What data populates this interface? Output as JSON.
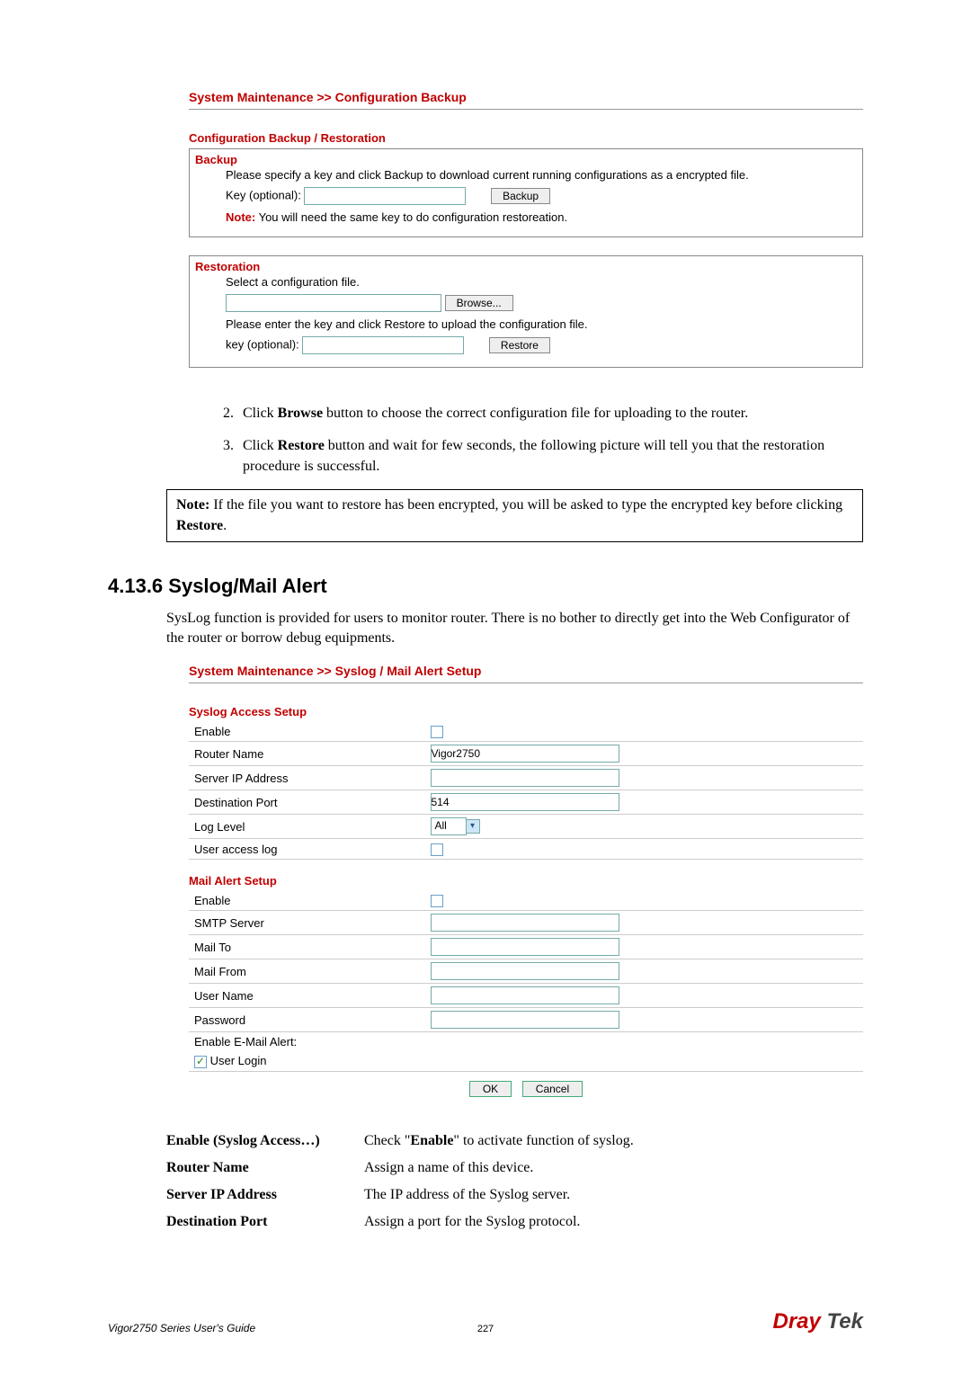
{
  "configBackup": {
    "breadcrumb": "System Maintenance >> Configuration Backup",
    "title": "Configuration Backup / Restoration",
    "backup": {
      "heading": "Backup",
      "instruction": "Please specify a key and click Backup to download current running configurations as a encrypted file.",
      "keyLabel": "Key (optional):",
      "keyValue": "",
      "buttonLabel": "Backup",
      "notePrefix": "Note:",
      "noteText": " You will need the same key to do configuration restoreation."
    },
    "restoration": {
      "heading": "Restoration",
      "selectLabel": "Select a configuration file.",
      "fileValue": "",
      "browseLabel": "Browse...",
      "instruction": "Please enter the key and click Restore to upload the configuration file.",
      "keyLabel": "key (optional):",
      "keyValue": "",
      "restoreLabel": "Restore"
    }
  },
  "steps": {
    "start": 2,
    "items": [
      {
        "prefix": "Click ",
        "bold": "Browse",
        "suffix": " button to choose the correct configuration file for uploading to the router."
      },
      {
        "prefix": "Click ",
        "bold": "Restore",
        "suffix": " button and wait for few seconds, the following picture will tell you that the restoration procedure is successful."
      }
    ]
  },
  "noteBox": {
    "prefix": "Note:",
    "mid1": " If the file you want to restore has been encrypted, you will be asked to type the encrypted key before clicking ",
    "bold": "Restore",
    "suffix": "."
  },
  "syslogSection": {
    "heading": "4.13.6 Syslog/Mail Alert",
    "intro": "SysLog function is provided for users to monitor router. There is no bother to directly get into the Web Configurator of the router or borrow debug equipments.",
    "breadcrumb": "System Maintenance >> Syslog / Mail Alert Setup",
    "syslogTitle": "Syslog Access Setup",
    "syslogRows": {
      "enable": "Enable",
      "routerName": "Router Name",
      "routerNameVal": "Vigor2750",
      "serverIp": "Server IP Address",
      "serverIpVal": "",
      "destPort": "Destination Port",
      "destPortVal": "514",
      "logLevel": "Log Level",
      "logLevelVal": "All",
      "userAccess": "User access log"
    },
    "mailTitle": "Mail Alert Setup",
    "mailRows": {
      "enable": "Enable",
      "smtp": "SMTP Server",
      "smtpVal": "",
      "mailTo": "Mail To",
      "mailToVal": "",
      "mailFrom": "Mail From",
      "mailFromVal": "",
      "userName": "User Name",
      "userNameVal": "",
      "password": "Password",
      "passwordVal": "",
      "enableAlert": "Enable E-Mail Alert:",
      "userLogin": "User Login"
    },
    "okLabel": "OK",
    "cancelLabel": "Cancel"
  },
  "definitions": [
    {
      "term": "Enable (Syslog Access…)",
      "pre": "Check \"",
      "bold": "Enable",
      "post": "\" to activate function of syslog."
    },
    {
      "term": "Router Name",
      "desc": "Assign a name of this device."
    },
    {
      "term": "Server IP Address",
      "desc": "The IP address of the Syslog server."
    },
    {
      "term": "Destination Port",
      "desc": "Assign a port for the Syslog protocol."
    }
  ],
  "footer": {
    "guide": "Vigor2750 Series User's Guide",
    "page": "227",
    "logo1": "Dray",
    "logo2": "Tek"
  }
}
